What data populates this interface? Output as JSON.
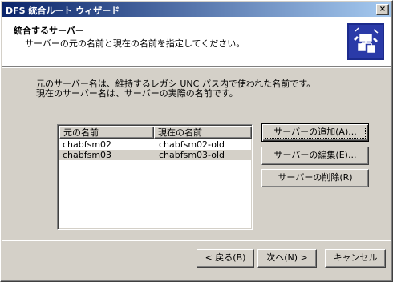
{
  "window": {
    "title": "DFS 統合ルート ウィザード",
    "close_glyph": "×"
  },
  "header": {
    "title": "統合するサーバー",
    "subtitle": "サーバーの元の名前と現在の名前を指定してください。",
    "icon": "wizard-tree-icon"
  },
  "description": {
    "line1": "元のサーバー名は、維持するレガシ UNC パス内で使われた名前です。",
    "line2": "現在のサーバー名は、サーバーの実際の名前です。"
  },
  "list": {
    "columns": [
      "元の名前",
      "現在の名前"
    ],
    "rows": [
      {
        "original": "chabfsm02",
        "current": "chabfsm02-old",
        "selected": false
      },
      {
        "original": "chabfsm03",
        "current": "chabfsm03-old",
        "selected": true
      }
    ]
  },
  "side_buttons": {
    "add": "サーバーの追加(A)...",
    "edit": "サーバーの編集(E)...",
    "remove": "サーバーの削除(R)"
  },
  "nav_buttons": {
    "back": "< 戻る(B)",
    "next": "次へ(N) >",
    "cancel": "キャンセル"
  }
}
